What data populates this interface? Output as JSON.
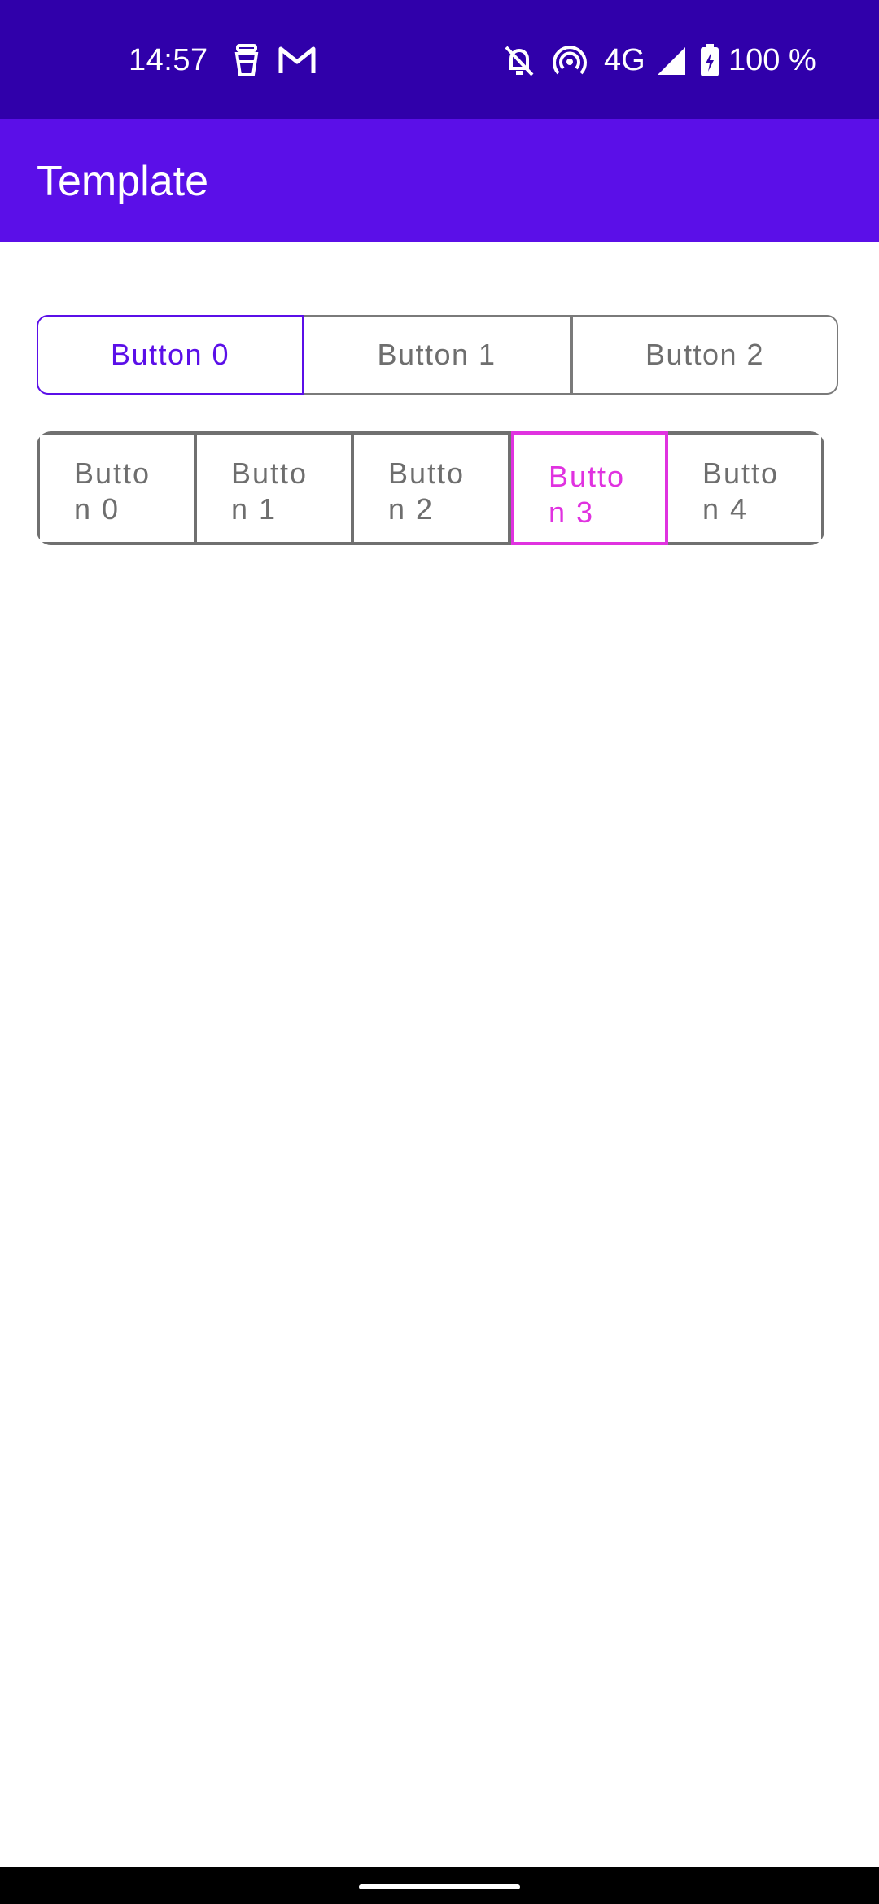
{
  "status_bar": {
    "time": "14:57",
    "network": "4G",
    "battery": "100 %",
    "icons": [
      "tray-icon",
      "gmail-icon",
      "bell-off-icon",
      "hotspot-icon",
      "signal-icon",
      "battery-charging-icon"
    ],
    "background_color": "#3000AA"
  },
  "app_bar": {
    "title": "Template",
    "background_color": "#5B0FE8"
  },
  "toggle_group_1": {
    "buttons": [
      {
        "label": "Button 0",
        "selected": true
      },
      {
        "label": "Button 1",
        "selected": false
      },
      {
        "label": "Button 2",
        "selected": false
      }
    ],
    "selected_color": "#5B0FE8"
  },
  "toggle_group_2": {
    "buttons": [
      {
        "label": "Butto\nn 0",
        "selected": false
      },
      {
        "label": "Butto\nn 1",
        "selected": false
      },
      {
        "label": "Butto\nn 2",
        "selected": false
      },
      {
        "label": "Butto\nn 3",
        "selected": true
      },
      {
        "label": "Butto\nn 4",
        "selected": false
      }
    ],
    "selected_color": "#E032E0"
  }
}
